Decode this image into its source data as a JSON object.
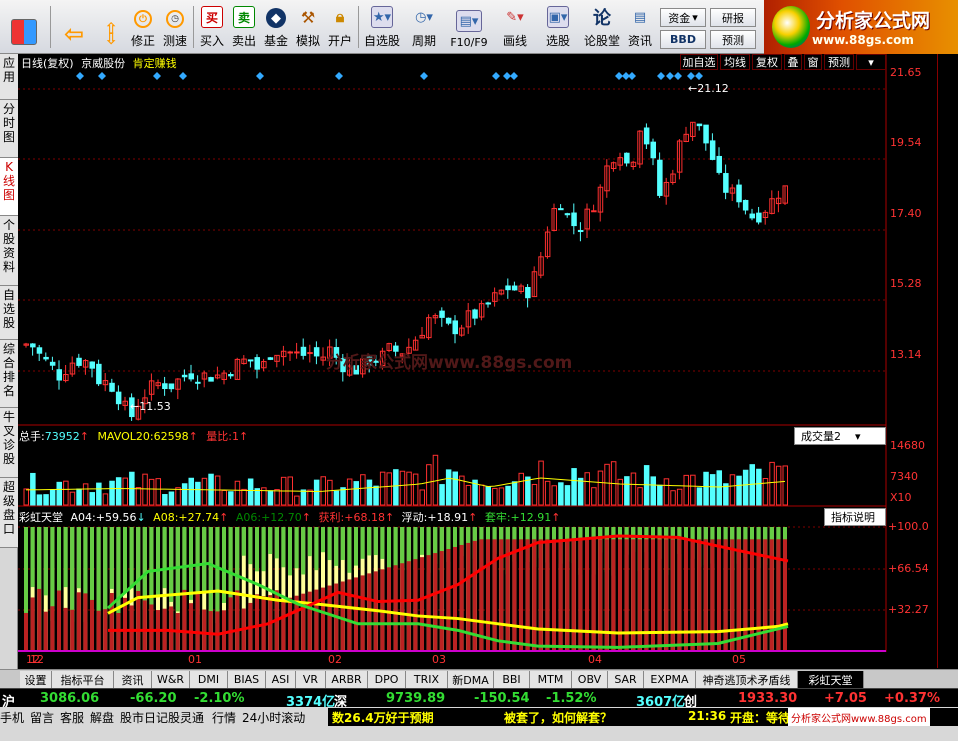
{
  "toolbar": {
    "buttons": [
      {
        "key": "back",
        "label": ""
      },
      {
        "key": "fix",
        "label": "修正"
      },
      {
        "key": "test",
        "label": "测速"
      },
      {
        "key": "buy",
        "label": "买入"
      },
      {
        "key": "sell",
        "label": "卖出"
      },
      {
        "key": "fund",
        "label": "基金"
      },
      {
        "key": "sim",
        "label": "模拟"
      },
      {
        "key": "open",
        "label": "开户"
      },
      {
        "key": "selfsel",
        "label": "自选股"
      },
      {
        "key": "period",
        "label": "周期"
      },
      {
        "key": "f10",
        "label": "F10/F9"
      },
      {
        "key": "draw",
        "label": "画线"
      },
      {
        "key": "pick",
        "label": "选股"
      },
      {
        "key": "forum",
        "label": "论股堂"
      },
      {
        "key": "news",
        "label": "资讯"
      }
    ],
    "small": {
      "fund_flow": "资金",
      "bbd": "BBD",
      "research": "研报",
      "alert": "预测"
    }
  },
  "brand": {
    "name": "分析家公式网",
    "url": "www.88gs.com"
  },
  "left_tabs": [
    "应用",
    "分时图",
    "K线图",
    "个股资料",
    "自选股",
    "综合排名",
    "牛叉诊股",
    "超级盘口"
  ],
  "main_chart": {
    "header": {
      "period": "日线(复权)",
      "stock": "京威股份",
      "indicator": "肯定赚钱"
    },
    "buttons": [
      "加自选",
      "均线",
      "复权",
      "叠",
      "窗",
      "预测"
    ],
    "y_ticks": [
      "21.65",
      "19.54",
      "17.40",
      "15.28",
      "13.14"
    ],
    "high_label": "21.12",
    "low_label": "11.53",
    "watermark": "分析家公式网www.88gs.com"
  },
  "volume_panel": {
    "total": "总手:",
    "total_val": "73952",
    "mavol": "MAVOL20:",
    "mavol_val": "62598",
    "ratio": "量比:",
    "ratio_val": "1",
    "selector": "成交量2",
    "y_ticks": [
      "14680",
      "7340",
      "X10"
    ]
  },
  "rainbow_panel": {
    "name": "彩虹天堂",
    "a04": "A04:",
    "a04_val": "+59.56",
    "a08": "A08:",
    "a08_val": "+27.74",
    "a06": "A06:",
    "a06_val": "+12.70",
    "profit": "获利:",
    "profit_val": "+68.18",
    "float": "浮动:",
    "float_val": "+18.91",
    "trap": "套牢:",
    "trap_val": "+12.91",
    "help": "指标说明",
    "y_ticks": [
      "+100.0",
      "+66.54",
      "+32.27"
    ]
  },
  "x_axis": [
    "12",
    "01",
    "02",
    "03",
    "04",
    "05"
  ],
  "bottom_tabs": [
    "设置",
    "指标平台",
    "资讯",
    "W&R",
    "DMI",
    "BIAS",
    "ASI",
    "VR",
    "ARBR",
    "DPO",
    "TRIX",
    "新DMA",
    "BBI",
    "MTM",
    "OBV",
    "SAR",
    "EXPMA",
    "神奇逃顶术矛盾线",
    "彩虹天堂"
  ],
  "status1": {
    "sh": "沪",
    "sh_val": "3086.06",
    "sh_chg": "-66.20",
    "sh_pct": "-2.10%",
    "sh_amt": "3374亿",
    "sz": "深",
    "sz_val": "9739.89",
    "sz_chg": "-150.54",
    "sz_pct": "-1.52%",
    "sz_amt": "3607亿",
    "cy": "创",
    "cy_val": "1933.30",
    "cy_chg": "+7.05",
    "cy_pct": "+0.37%"
  },
  "status2": {
    "items": [
      "手机",
      "留言",
      "客服",
      "解盘",
      "股市日记",
      "股灵通",
      "行情",
      "24小时滚动"
    ],
    "ticker1": "数26.4万好于预期",
    "ticker2": "被套了，如何解套？",
    "time": "21:36",
    "ticker3": "开盘：等待",
    "footer_brand": "分析家公式网www.88gs.com"
  },
  "colors": {
    "up": "#ff3030",
    "down": "#54ffff",
    "grid": "#800000",
    "yellow": "#ffff00",
    "green": "#33dd33",
    "red": "#ff0000"
  }
}
